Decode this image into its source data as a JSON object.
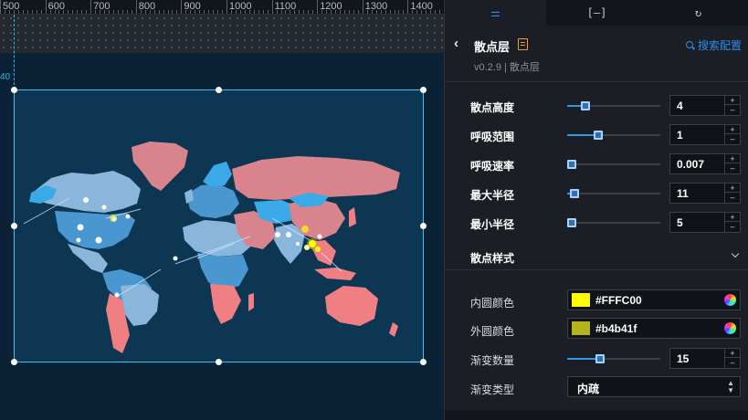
{
  "ruler": {
    "labels": [
      "500",
      "600",
      "700",
      "800",
      "900",
      "1000",
      "1100",
      "1200",
      "1300",
      "1400"
    ],
    "guide_label": "40"
  },
  "map": {
    "land_colors": [
      "#d9848c",
      "#4a96d0",
      "#8ab6dc",
      "#f07f83",
      "#3aa9e8"
    ],
    "ocean_color": "#0c3652",
    "point_inner_color": "#FFFC00",
    "point_outer_color": "#b4b41f"
  },
  "tabs": [
    {
      "name": "sliders-icon",
      "label": "⚌"
    },
    {
      "name": "bracket-icon",
      "label": "[–]"
    },
    {
      "name": "refresh-icon",
      "label": "↻"
    }
  ],
  "header": {
    "title": "散点层",
    "version": "v0.2.9 | 散点层",
    "search_label": "搜索配置"
  },
  "settings": [
    {
      "label": "散点高度",
      "value": "4",
      "fraction": 0.2
    },
    {
      "label": "呼吸范围",
      "value": "1",
      "fraction": 0.33
    },
    {
      "label": "呼吸速率",
      "value": "0.007",
      "fraction": 0.0
    },
    {
      "label": "最大半径",
      "value": "11",
      "fraction": 0.08
    },
    {
      "label": "最小半径",
      "value": "5",
      "fraction": 0.05
    }
  ],
  "style_section": {
    "label": "散点样式",
    "inner_color_label": "内圆颜色",
    "inner_color_value": "#FFFC00",
    "outer_color_label": "外圆颜色",
    "outer_color_value": "#b4b41f",
    "gradient_count_label": "渐变数量",
    "gradient_count_value": "15",
    "gradient_count_fraction": 0.35,
    "gradient_type_label": "渐变类型",
    "gradient_type_value": "内疏"
  }
}
